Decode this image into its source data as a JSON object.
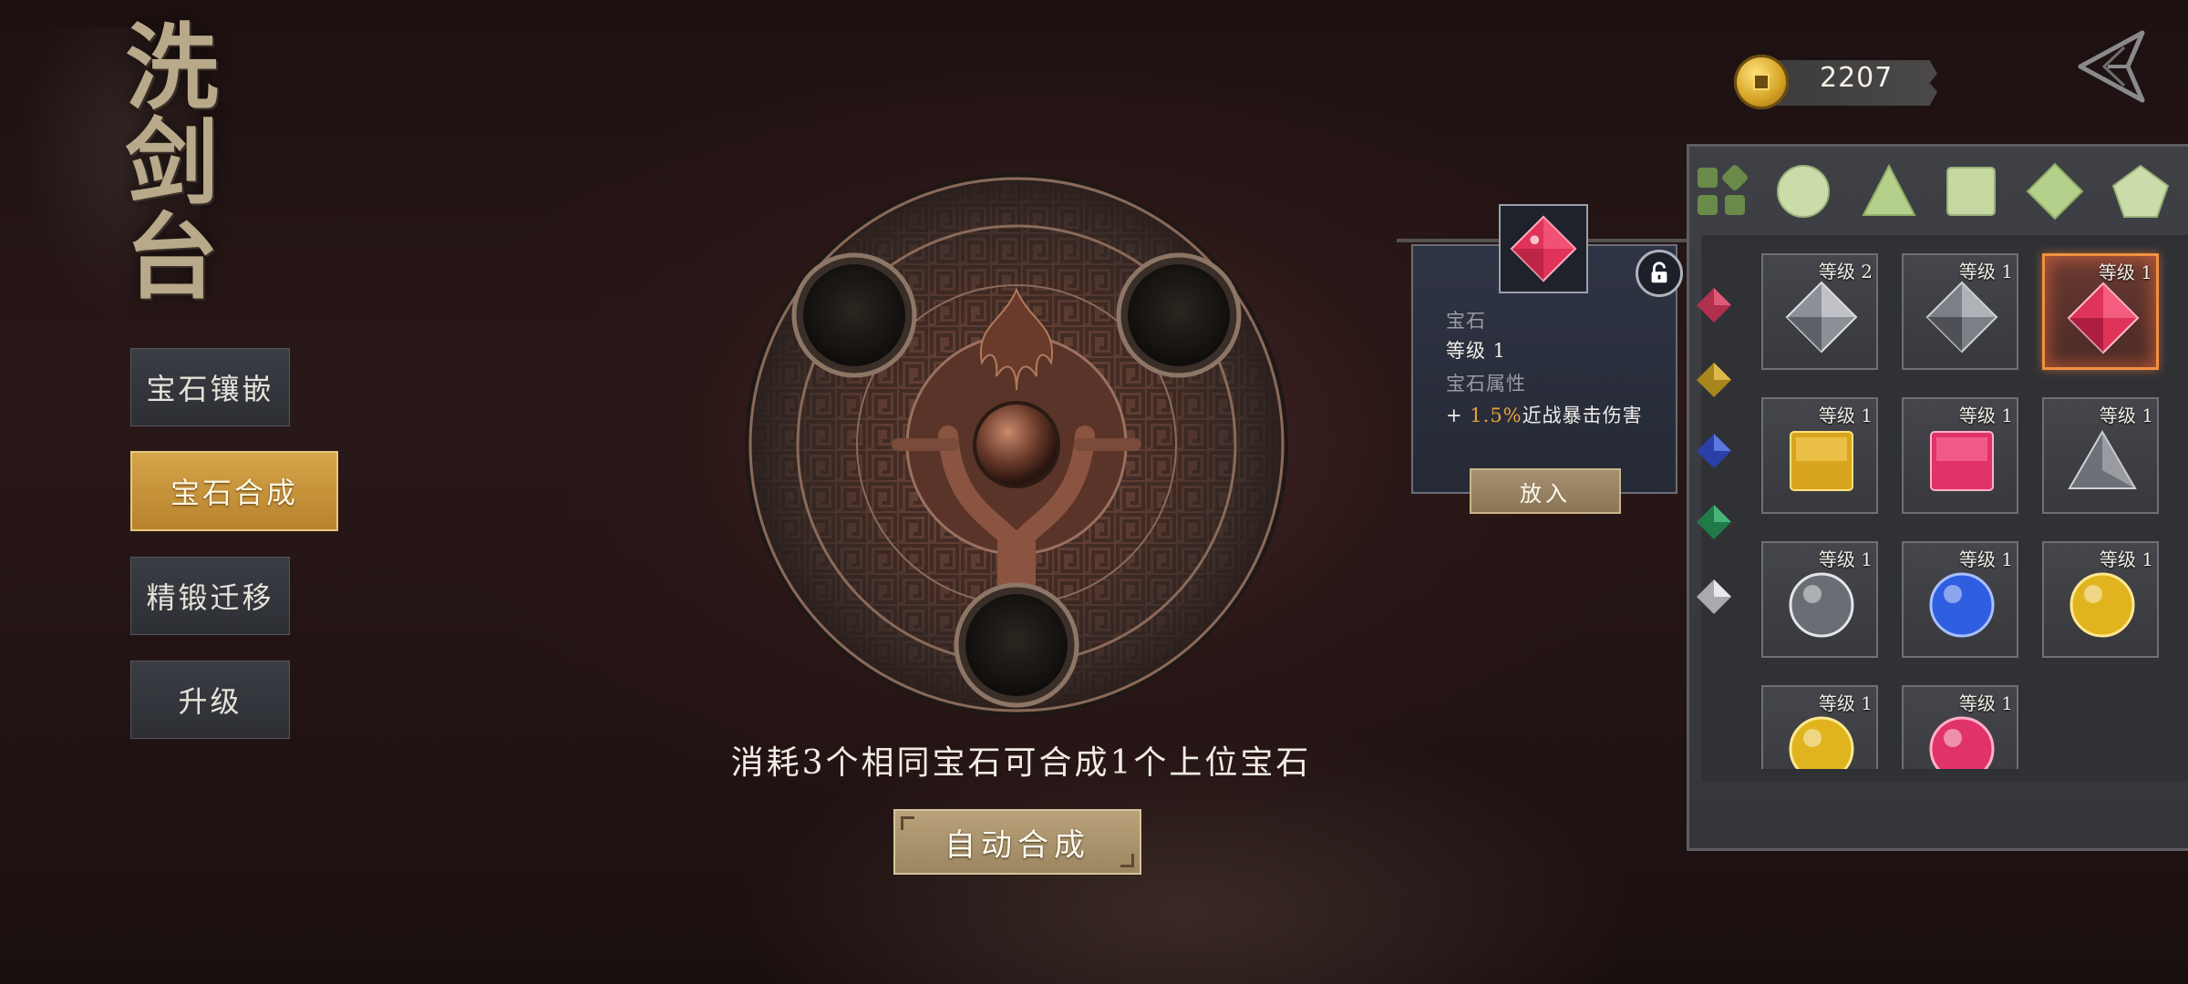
{
  "title": "洗剑台",
  "menu": {
    "items": [
      {
        "label": "宝石镶嵌",
        "active": false
      },
      {
        "label": "宝石合成",
        "active": true
      },
      {
        "label": "精锻迁移",
        "active": false
      },
      {
        "label": "升级",
        "active": false
      }
    ]
  },
  "synthesis": {
    "hint": "消耗3个相同宝石可合成1个上位宝石",
    "auto_button": "自动合成"
  },
  "currency": {
    "icon": "coin-icon",
    "amount": "2207"
  },
  "back_button": {
    "icon": "back-arrow-icon"
  },
  "tooltip": {
    "type": "宝石",
    "level": "等级 1",
    "attr_title": "宝石属性",
    "stat_prefix": "+ ",
    "stat_value": "1.5%",
    "stat_name": "近战暴击伤害",
    "place_button": "放入",
    "gem_color": "#e0335a"
  },
  "filters": [
    {
      "icon": "grid-all-icon"
    },
    {
      "icon": "circle-shape-icon"
    },
    {
      "icon": "triangle-shape-icon"
    },
    {
      "icon": "square-shape-icon"
    },
    {
      "icon": "diamond-shape-icon"
    },
    {
      "icon": "pentagon-shape-icon"
    }
  ],
  "categories": [
    {
      "icon": "red-gem-category-icon",
      "color": "#c0385a"
    },
    {
      "icon": "yellow-gem-category-icon",
      "color": "#c9a227"
    },
    {
      "icon": "blue-gem-category-icon",
      "color": "#3a55c9"
    },
    {
      "icon": "green-gem-category-icon",
      "color": "#2e9a5c"
    },
    {
      "icon": "white-gem-category-icon",
      "color": "#c8cad0"
    }
  ],
  "inventory": [
    {
      "level": "等级 2",
      "shape": "diamond",
      "color": "#b9bcc4"
    },
    {
      "level": "等级 1",
      "shape": "diamond",
      "color": "#a9acb4"
    },
    {
      "level": "等级 1",
      "shape": "diamond",
      "color": "#e0335a",
      "selected": true
    },
    {
      "level": "等级 1",
      "shape": "square",
      "color": "#d9a41e"
    },
    {
      "level": "等级 1",
      "shape": "square",
      "color": "#e0336a"
    },
    {
      "level": "等级 1",
      "shape": "triangle",
      "color": "#9a9ca4"
    },
    {
      "level": "等级 1",
      "shape": "circle",
      "color": "#9fa2aa"
    },
    {
      "level": "等级 1",
      "shape": "circle",
      "color": "#2f5ee0"
    },
    {
      "level": "等级 1",
      "shape": "circle",
      "color": "#e0b41e"
    },
    {
      "level": "等级 1",
      "shape": "circle",
      "color": "#e0b41e"
    },
    {
      "level": "等级 1",
      "shape": "circle",
      "color": "#e0336a"
    }
  ]
}
